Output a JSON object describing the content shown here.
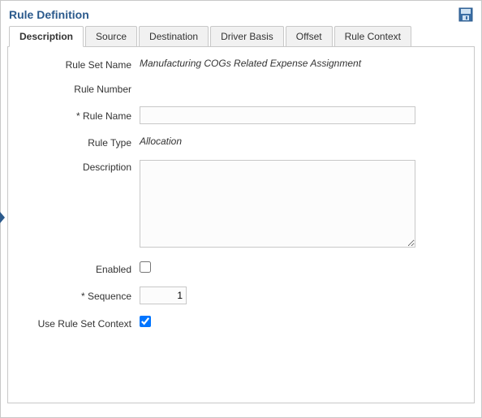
{
  "panel": {
    "title": "Rule Definition"
  },
  "tabs": {
    "description": "Description",
    "source": "Source",
    "destination": "Destination",
    "driver_basis": "Driver Basis",
    "offset": "Offset",
    "rule_context": "Rule Context"
  },
  "form": {
    "labels": {
      "rule_set_name": "Rule Set Name",
      "rule_number": "Rule Number",
      "rule_name": "Rule Name",
      "rule_type": "Rule Type",
      "description": "Description",
      "enabled": "Enabled",
      "sequence": "Sequence",
      "use_rule_set_context": "Use Rule Set Context"
    },
    "values": {
      "rule_set_name": "Manufacturing COGs Related Expense Assignment",
      "rule_number": "",
      "rule_name": "",
      "rule_type": "Allocation",
      "description": "",
      "sequence": "1"
    }
  }
}
